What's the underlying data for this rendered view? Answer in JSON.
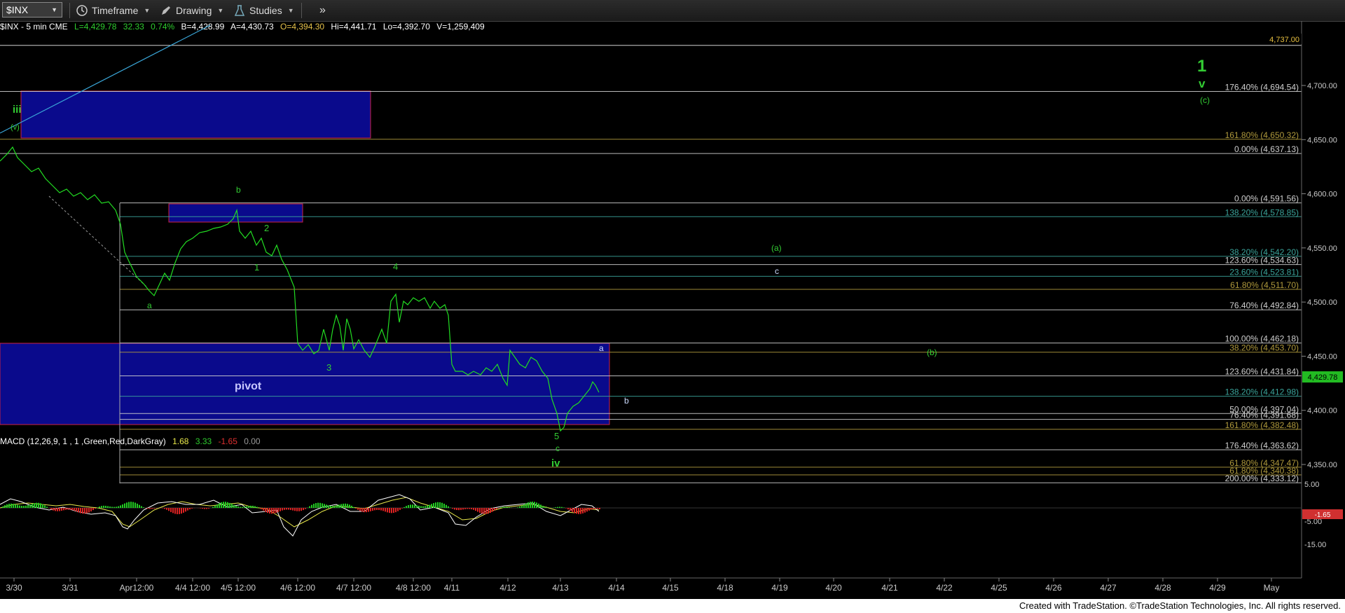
{
  "toolbar": {
    "symbol": "$INX",
    "timeframe_label": "Timeframe",
    "drawing_label": "Drawing",
    "studies_label": "Studies",
    "more_label": "»"
  },
  "quote": {
    "symbol_desc": "$INX - 5 min  CME",
    "last": "L=4,429.78",
    "change": "32.33",
    "pct": "0.74%",
    "bid": "B=4,428.99",
    "ask": "A=4,430.73",
    "open": "O=4,394.30",
    "high": "Hi=4,441.71",
    "low": "Lo=4,392.70",
    "volume": "V=1,259,409"
  },
  "price_axis": {
    "ticks": [
      "4,700.00",
      "4,650.00",
      "4,600.00",
      "4,550.00",
      "4,500.00",
      "4,450.00",
      "4,400.00",
      "4,350.00"
    ],
    "top_label": "4,737.00",
    "current": "4,429.78"
  },
  "macd": {
    "label": "MACD (12,26,9, 1 , 1 ,Green,Red,DarkGray)",
    "v1": "1.68",
    "v2": "3.33",
    "v3": "-1.65",
    "v4": "0.00",
    "axis": [
      "5.00",
      "-5.00",
      "-15.00"
    ],
    "current": "-1.65"
  },
  "date_axis": [
    "3/30",
    "3/31",
    "Apr12:00",
    "4/4 12:00",
    "4/5 12:00",
    "4/6 12:00",
    "4/7 12:00",
    "4/8 12:00",
    "4/11",
    "4/12",
    "4/13",
    "4/14",
    "4/15",
    "4/18",
    "4/19",
    "4/20",
    "4/21",
    "4/22",
    "4/25",
    "4/26",
    "4/27",
    "4/28",
    "4/29",
    "May"
  ],
  "fib_labels": [
    {
      "text": "176.40% (4,694.54)",
      "color": "#cfcfcf"
    },
    {
      "text": "161.80% (4,650.32)",
      "color": "#b09a3c"
    },
    {
      "text": "0.00% (4,637.13)",
      "color": "#cfcfcf"
    },
    {
      "text": "0.00% (4,591.56)",
      "color": "#cfcfcf"
    },
    {
      "text": "138.20% (4,578.85)",
      "color": "#3aa39a"
    },
    {
      "text": "38.20% (4,542.20)",
      "color": "#3aa39a"
    },
    {
      "text": "123.60% (4,534.63)",
      "color": "#cfcfcf"
    },
    {
      "text": "23.60% (4,523.81)",
      "color": "#3aa39a"
    },
    {
      "text": "61.80% (4,511.70)",
      "color": "#b09a3c"
    },
    {
      "text": "76.40% (4,492.84)",
      "color": "#cfcfcf"
    },
    {
      "text": "100.00% (4,462.18)",
      "color": "#cfcfcf"
    },
    {
      "text": "38.20% (4,453.70)",
      "color": "#b09a3c"
    },
    {
      "text": "123.60% (4,431.84)",
      "color": "#cfcfcf"
    },
    {
      "text": "138.20% (4,412.98)",
      "color": "#3aa39a"
    },
    {
      "text": "50.00% (4,397.04)",
      "color": "#cfcfcf"
    },
    {
      "text": "76.40% (4,391.68)",
      "color": "#cfcfcf"
    },
    {
      "text": "161.80% (4,382.48)",
      "color": "#b09a3c"
    },
    {
      "text": "176.40% (4,363.62)",
      "color": "#cfcfcf"
    },
    {
      "text": "61.80% (4,347.47)",
      "color": "#b09a3c"
    },
    {
      "text": "61.80% (4,340.38)",
      "color": "#b09a3c"
    },
    {
      "text": "200.00% (4,333.12)",
      "color": "#cfcfcf"
    }
  ],
  "wave_labels": {
    "iii": "iii",
    "v_paren": "(v)",
    "b": "b",
    "two": "2",
    "one": "1",
    "a": "a",
    "four": "4",
    "three": "3",
    "five": "5",
    "c": "c",
    "iv": "iv",
    "a2": "a",
    "b2": "b",
    "a_paren": "(a)",
    "c2": "c",
    "b_paren": "(b)",
    "one_big": "1",
    "v_big": "v",
    "c_paren": "(c)",
    "pivot": "pivot"
  },
  "footer": "Created with TradeStation. ©TradeStation Technologies, Inc. All rights reserved.",
  "colors": {
    "price": "#22dd22",
    "box_fill": "#0a0a8c",
    "box_border": "#cc2244",
    "wave_green": "#33cc33",
    "axis_text": "#cccccc"
  }
}
